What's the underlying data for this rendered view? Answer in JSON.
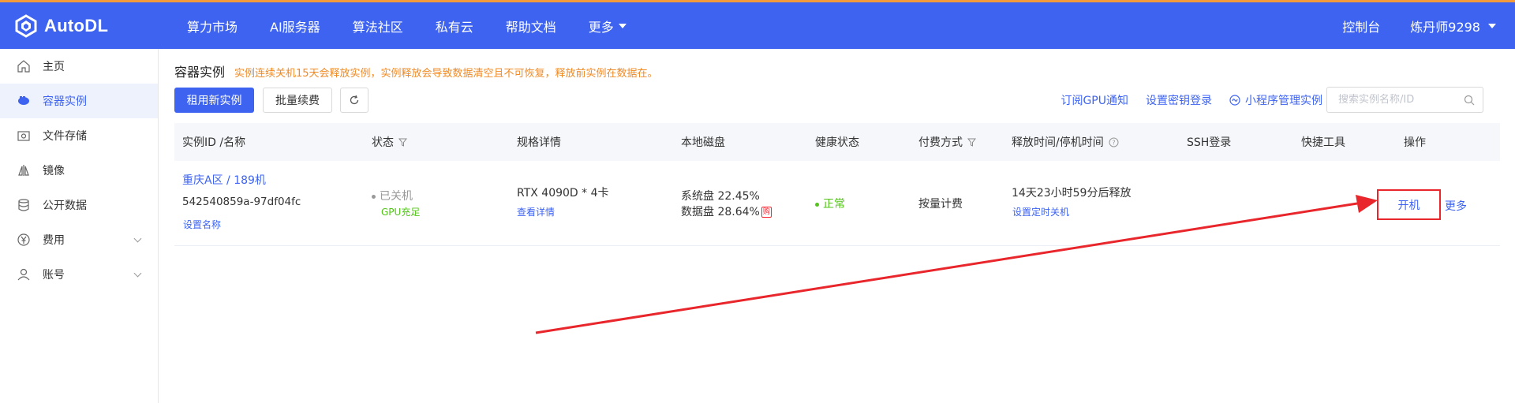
{
  "topnav": {
    "logo_text": "AutoDL",
    "items": [
      "算力市场",
      "AI服务器",
      "算法社区",
      "私有云",
      "帮助文档",
      "更多"
    ],
    "console": "控制台",
    "user": "炼丹师9298"
  },
  "sidebar": {
    "items": [
      {
        "label": "主页",
        "icon": "home-icon"
      },
      {
        "label": "容器实例",
        "icon": "container-icon"
      },
      {
        "label": "文件存储",
        "icon": "storage-icon"
      },
      {
        "label": "镜像",
        "icon": "image-icon"
      },
      {
        "label": "公开数据",
        "icon": "database-icon"
      },
      {
        "label": "费用",
        "icon": "yen-icon"
      },
      {
        "label": "账号",
        "icon": "user-icon"
      }
    ]
  },
  "page": {
    "title": "容器实例",
    "warning": "实例连续关机15天会释放实例，实例释放会导致数据清空且不可恢复，释放前实例在数据在。"
  },
  "toolbar": {
    "new_instance": "租用新实例",
    "batch_renew": "批量续费",
    "subscribe_gpu": "订阅GPU通知",
    "set_key_login": "设置密钥登录",
    "mini_program": "小程序管理实例",
    "search_placeholder": "搜索实例名称/ID"
  },
  "table": {
    "headers": [
      "实例ID /名称",
      "状态",
      "规格详情",
      "本地磁盘",
      "健康状态",
      "付费方式",
      "释放时间/停机时间",
      "SSH登录",
      "快捷工具",
      "操作"
    ],
    "rows": [
      {
        "region": "重庆A区 / 189机",
        "instance_id": "542540859a-97df04fc",
        "set_name": "设置名称",
        "status": "已关机",
        "gpu_status": "GPU充足",
        "spec": "RTX 4090D * 4卡",
        "view_detail": "查看详情",
        "system_disk": "系统盘 22.45%",
        "data_disk": "数据盘 28.64%",
        "disk_badge": "购",
        "health": "正常",
        "billing": "按量计费",
        "release_time": "14天23小时59分后释放",
        "set_shutdown": "设置定时关机",
        "action_start": "开机",
        "action_more": "更多"
      }
    ]
  },
  "colors": {
    "primary": "#3d63f0",
    "warning": "#f08a24",
    "healthy": "#52c41a",
    "annotation": "#e8262b"
  }
}
